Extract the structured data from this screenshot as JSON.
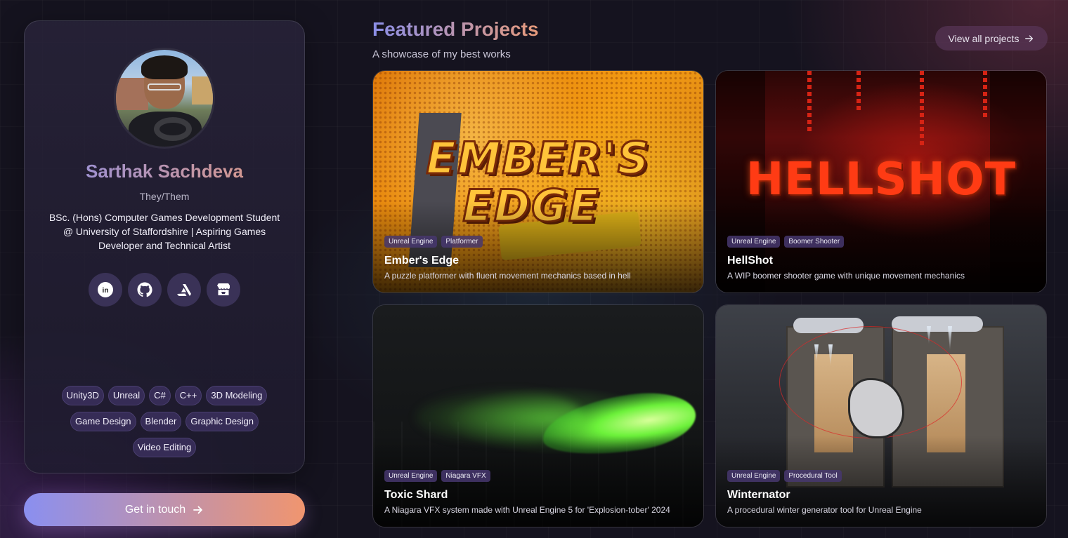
{
  "profile": {
    "name": "Sarthak Sachdeva",
    "pronouns": "They/Them",
    "bio": "BSc. (Hons) Computer Games Development Student @ University of Staffordshire | Aspiring Games Developer and Technical Artist",
    "socials": [
      {
        "icon": "linkedin-icon"
      },
      {
        "icon": "github-icon"
      },
      {
        "icon": "artstation-icon"
      },
      {
        "icon": "itchio-icon"
      }
    ],
    "skills": [
      "Unity3D",
      "Unreal",
      "C#",
      "C++",
      "3D Modeling",
      "Game Design",
      "Blender",
      "Graphic Design",
      "Video Editing"
    ],
    "cta_label": "Get in touch"
  },
  "projects_section": {
    "title": "Featured Projects",
    "subtitle": "A showcase of my best works",
    "view_all_label": "View all projects"
  },
  "projects": [
    {
      "logo_lines": [
        "EMBER'S",
        "EDGE"
      ],
      "tags": [
        "Unreal Engine",
        "Platformer"
      ],
      "title": "Ember's Edge",
      "description": "A puzzle platformer with fluent movement mechanics based in hell"
    },
    {
      "logo_lines": [
        "HELLSHOT"
      ],
      "tags": [
        "Unreal Engine",
        "Boomer Shooter"
      ],
      "title": "HellShot",
      "description": "A WIP boomer shooter game with unique movement mechanics"
    },
    {
      "tags": [
        "Unreal Engine",
        "Niagara VFX"
      ],
      "title": "Toxic Shard",
      "description": "A Niagara VFX system made with Unreal Engine 5 for 'Explosion-tober' 2024"
    },
    {
      "tags": [
        "Unreal Engine",
        "Procedural Tool"
      ],
      "title": "Winternator",
      "description": "A procedural winter generator tool for Unreal Engine"
    }
  ],
  "colors": {
    "accent_start": "#8b8fe8",
    "accent_end": "#e79a7a",
    "background": "#15131f",
    "chip": "#362c56"
  }
}
